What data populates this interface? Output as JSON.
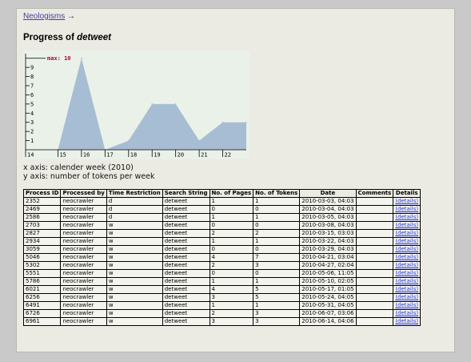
{
  "breadcrumb": {
    "link": "Neologisms",
    "arrow": "→"
  },
  "title": {
    "prefix": "Progress of",
    "term": "detweet"
  },
  "chart_data": {
    "type": "area",
    "max_label": "max: 10",
    "x": [
      14,
      15,
      16,
      17,
      18,
      19,
      20,
      21,
      22,
      23
    ],
    "values": [
      0,
      0,
      10,
      0,
      1,
      5,
      5,
      1,
      3,
      3
    ],
    "x_tick_labels": [
      "14",
      "15",
      "16",
      "17",
      "18",
      "19",
      "20",
      "21",
      "22"
    ],
    "y_tick_labels": [
      "1",
      "2",
      "3",
      "4",
      "5",
      "6",
      "7",
      "8",
      "9"
    ],
    "ylim": [
      0,
      10.5
    ],
    "fill_color": "#a7bdd3",
    "background_color": "#e9f1e9",
    "max_color": "#b0004a"
  },
  "axis_notes": {
    "x": "x axis: calender week (2010)",
    "y": "y axis: number of tokens per week"
  },
  "table": {
    "headers": [
      "Process ID",
      "Processed by",
      "Time Restriction",
      "Search String",
      "No. of Pages",
      "No. of Tokens",
      "Date",
      "Comments",
      "Details"
    ],
    "rows": [
      [
        "2352",
        "neocrawler",
        "d",
        "detweet",
        "1",
        "1",
        "2010-03-03, 04:03",
        "",
        "(details)"
      ],
      [
        "2469",
        "neocrawler",
        "d",
        "detweet",
        "0",
        "0",
        "2010-03-04, 04:03",
        "",
        "(details)"
      ],
      [
        "2586",
        "neocrawler",
        "d",
        "detweet",
        "1",
        "1",
        "2010-03-05, 04:03",
        "",
        "(details)"
      ],
      [
        "2703",
        "neocrawler",
        "w",
        "detweet",
        "0",
        "0",
        "2010-03-08, 04:03",
        "",
        "(details)"
      ],
      [
        "2827",
        "neocrawler",
        "w",
        "detweet",
        "2",
        "2",
        "2010-03-15, 03:03",
        "",
        "(details)"
      ],
      [
        "2934",
        "neocrawler",
        "w",
        "detweet",
        "1",
        "1",
        "2010-03-22, 04:03",
        "",
        "(details)"
      ],
      [
        "3059",
        "neocrawler",
        "w",
        "detweet",
        "0",
        "0",
        "2010-03-29, 04:03",
        "",
        "(details)"
      ],
      [
        "5046",
        "neocrawler",
        "w",
        "detweet",
        "4",
        "7",
        "2010-04-21, 03:04",
        "",
        "(details)"
      ],
      [
        "5302",
        "neocrawler",
        "w",
        "detweet",
        "2",
        "3",
        "2010-04-27, 02:04",
        "",
        "(details)"
      ],
      [
        "5551",
        "neocrawler",
        "w",
        "detweet",
        "0",
        "0",
        "2010-05-06, 11:05",
        "",
        "(details)"
      ],
      [
        "5786",
        "neocrawler",
        "w",
        "detweet",
        "1",
        "1",
        "2010-05-10, 02:05",
        "",
        "(details)"
      ],
      [
        "6021",
        "neocrawler",
        "w",
        "detweet",
        "4",
        "5",
        "2010-05-17, 01:05",
        "",
        "(details)"
      ],
      [
        "6256",
        "neocrawler",
        "w",
        "detweet",
        "3",
        "5",
        "2010-05-24, 04:05",
        "",
        "(details)"
      ],
      [
        "6491",
        "neocrawler",
        "w",
        "detweet",
        "1",
        "1",
        "2010-05-31, 04:05",
        "",
        "(details)"
      ],
      [
        "6726",
        "neocrawler",
        "w",
        "detweet",
        "2",
        "3",
        "2010-06-07, 03:06",
        "",
        "(details)"
      ],
      [
        "6961",
        "neocrawler",
        "w",
        "detweet",
        "3",
        "3",
        "2010-06-14, 04:06",
        "",
        "(details)"
      ]
    ]
  }
}
